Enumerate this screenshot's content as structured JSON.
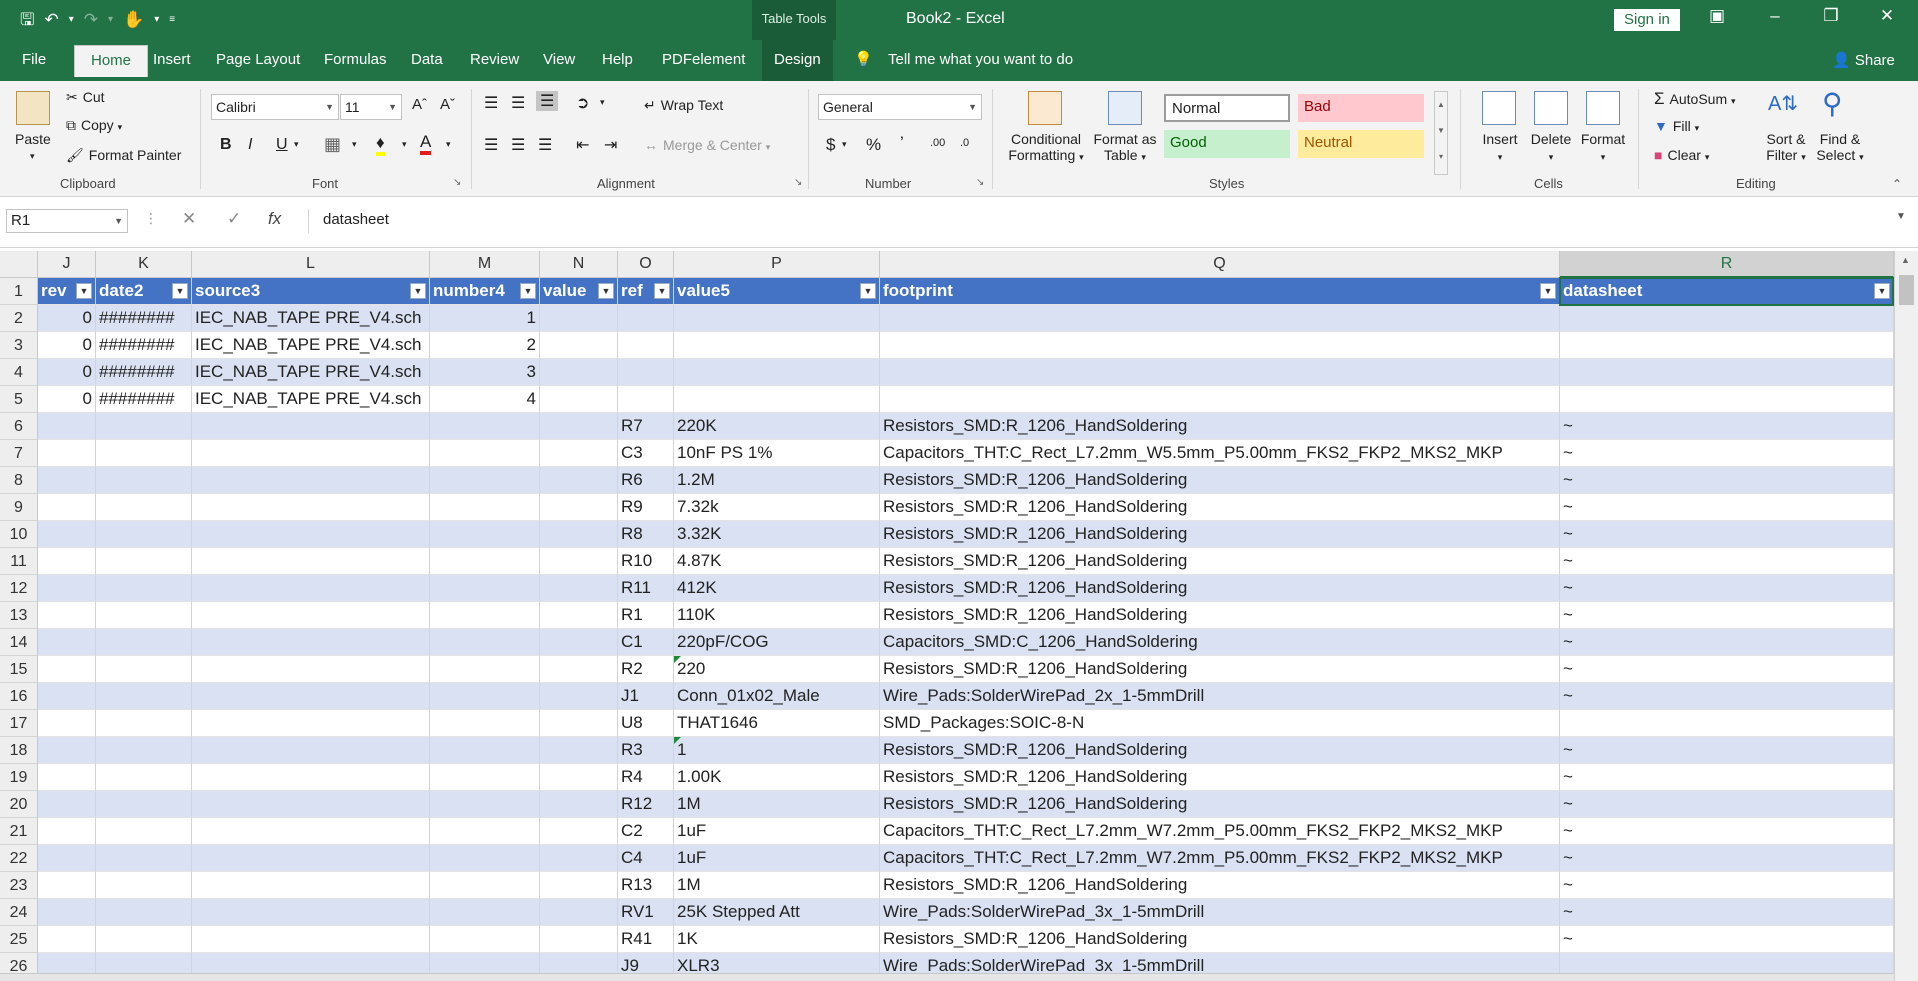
{
  "window": {
    "title": "Book2  -  Excel",
    "context_tab": "Table Tools",
    "sign_in": "Sign in"
  },
  "tabs": [
    "File",
    "Home",
    "Insert",
    "Page Layout",
    "Formulas",
    "Data",
    "Review",
    "View",
    "Help",
    "PDFelement",
    "Design"
  ],
  "tell_me": "Tell me what you want to do",
  "share": "Share",
  "ribbon": {
    "clipboard": {
      "paste": "Paste",
      "cut": "Cut",
      "copy": "Copy",
      "format_painter": "Format Painter",
      "label": "Clipboard"
    },
    "font": {
      "name": "Calibri",
      "size": "11",
      "label": "Font"
    },
    "alignment": {
      "wrap": "Wrap Text",
      "merge": "Merge & Center",
      "label": "Alignment"
    },
    "number": {
      "format": "General",
      "label": "Number"
    },
    "styles": {
      "conditional": "Conditional",
      "conditional2": "Formatting",
      "format_as": "Format as",
      "format_as2": "Table",
      "normal": "Normal",
      "bad": "Bad",
      "good": "Good",
      "neutral": "Neutral",
      "label": "Styles"
    },
    "cells": {
      "insert": "Insert",
      "delete": "Delete",
      "format": "Format",
      "label": "Cells"
    },
    "editing": {
      "autosum": "AutoSum",
      "fill": "Fill",
      "clear": "Clear",
      "sort": "Sort &",
      "sort2": "Filter",
      "find": "Find &",
      "find2": "Select",
      "label": "Editing"
    }
  },
  "formula_bar": {
    "name_box": "R1",
    "content": "datasheet"
  },
  "columns": [
    "J",
    "K",
    "L",
    "M",
    "N",
    "O",
    "P",
    "Q",
    "R"
  ],
  "headers": [
    "rev",
    "date2",
    "source3",
    "number4",
    "value",
    "ref",
    "value5",
    "footprint",
    "datasheet"
  ],
  "rows": [
    [
      "0",
      "########",
      "IEC_NAB_TAPE PRE_V4.sch",
      "1",
      "",
      "",
      "",
      "",
      ""
    ],
    [
      "0",
      "########",
      "IEC_NAB_TAPE PRE_V4.sch",
      "2",
      "",
      "",
      "",
      "",
      ""
    ],
    [
      "0",
      "########",
      "IEC_NAB_TAPE PRE_V4.sch",
      "3",
      "",
      "",
      "",
      "",
      ""
    ],
    [
      "0",
      "########",
      "IEC_NAB_TAPE PRE_V4.sch",
      "4",
      "",
      "",
      "",
      "",
      ""
    ],
    [
      "",
      "",
      "",
      "",
      "",
      "R7",
      "220K",
      "Resistors_SMD:R_1206_HandSoldering",
      "~"
    ],
    [
      "",
      "",
      "",
      "",
      "",
      "C3",
      "10nF PS 1%",
      "Capacitors_THT:C_Rect_L7.2mm_W5.5mm_P5.00mm_FKS2_FKP2_MKS2_MKP",
      "~"
    ],
    [
      "",
      "",
      "",
      "",
      "",
      "R6",
      "1.2M",
      "Resistors_SMD:R_1206_HandSoldering",
      "~"
    ],
    [
      "",
      "",
      "",
      "",
      "",
      "R9",
      "7.32k",
      "Resistors_SMD:R_1206_HandSoldering",
      "~"
    ],
    [
      "",
      "",
      "",
      "",
      "",
      "R8",
      "3.32K",
      "Resistors_SMD:R_1206_HandSoldering",
      "~"
    ],
    [
      "",
      "",
      "",
      "",
      "",
      "R10",
      "4.87K",
      "Resistors_SMD:R_1206_HandSoldering",
      "~"
    ],
    [
      "",
      "",
      "",
      "",
      "",
      "R11",
      "412K",
      "Resistors_SMD:R_1206_HandSoldering",
      "~"
    ],
    [
      "",
      "",
      "",
      "",
      "",
      "R1",
      "110K",
      "Resistors_SMD:R_1206_HandSoldering",
      "~"
    ],
    [
      "",
      "",
      "",
      "",
      "",
      "C1",
      "220pF/COG",
      "Capacitors_SMD:C_1206_HandSoldering",
      "~"
    ],
    [
      "",
      "",
      "",
      "",
      "",
      "R2",
      "220",
      "Resistors_SMD:R_1206_HandSoldering",
      "~"
    ],
    [
      "",
      "",
      "",
      "",
      "",
      "J1",
      "Conn_01x02_Male",
      "Wire_Pads:SolderWirePad_2x_1-5mmDrill",
      "~"
    ],
    [
      "",
      "",
      "",
      "",
      "",
      "U8",
      "THAT1646",
      "SMD_Packages:SOIC-8-N",
      ""
    ],
    [
      "",
      "",
      "",
      "",
      "",
      "R3",
      "1",
      "Resistors_SMD:R_1206_HandSoldering",
      "~"
    ],
    [
      "",
      "",
      "",
      "",
      "",
      "R4",
      "1.00K",
      "Resistors_SMD:R_1206_HandSoldering",
      "~"
    ],
    [
      "",
      "",
      "",
      "",
      "",
      "R12",
      "1M",
      "Resistors_SMD:R_1206_HandSoldering",
      "~"
    ],
    [
      "",
      "",
      "",
      "",
      "",
      "C2",
      "1uF",
      "Capacitors_THT:C_Rect_L7.2mm_W7.2mm_P5.00mm_FKS2_FKP2_MKS2_MKP",
      "~"
    ],
    [
      "",
      "",
      "",
      "",
      "",
      "C4",
      "1uF",
      "Capacitors_THT:C_Rect_L7.2mm_W7.2mm_P5.00mm_FKS2_FKP2_MKS2_MKP",
      "~"
    ],
    [
      "",
      "",
      "",
      "",
      "",
      "R13",
      "1M",
      "Resistors_SMD:R_1206_HandSoldering",
      "~"
    ],
    [
      "",
      "",
      "",
      "",
      "",
      "RV1",
      "25K Stepped Att",
      "Wire_Pads:SolderWirePad_3x_1-5mmDrill",
      "~"
    ],
    [
      "",
      "",
      "",
      "",
      "",
      "R41",
      "1K",
      "Resistors_SMD:R_1206_HandSoldering",
      "~"
    ],
    [
      "",
      "",
      "",
      "",
      "",
      "J9",
      "XLR3",
      "Wire_Pads:SolderWirePad_3x_1-5mmDrill",
      ""
    ]
  ],
  "colors": {
    "accent": "#217346",
    "table_header": "#4472c4",
    "band": "#d9e1f2"
  }
}
